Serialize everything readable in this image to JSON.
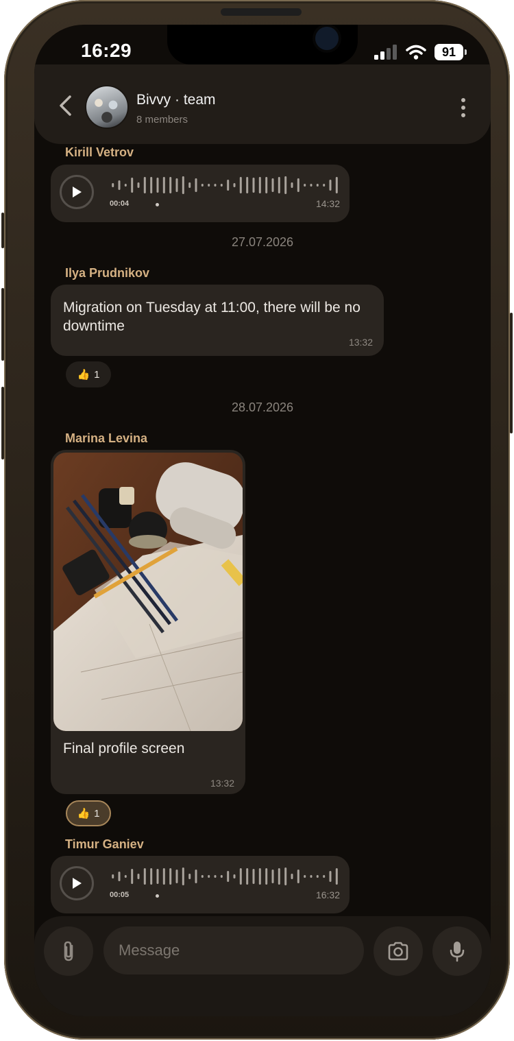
{
  "status": {
    "time": "16:29",
    "battery": "91"
  },
  "header": {
    "title": "Bivvy · team",
    "subtitle": "8 members"
  },
  "messages": [
    {
      "type": "voice",
      "sender": "Kirill Vetrov",
      "duration": "00:04",
      "time": "14:32"
    },
    {
      "type": "date",
      "label": "27.07.2026"
    },
    {
      "type": "text",
      "sender": "Ilya Prudnikov",
      "text": "Migration on Tuesday at 11:00, there will be no downtime",
      "time": "13:32",
      "reaction": {
        "emoji": "👍",
        "count": "1",
        "active": false
      }
    },
    {
      "type": "date",
      "label": "28.07.2026"
    },
    {
      "type": "photo",
      "sender": "Marina Levina",
      "caption": "Final profile screen",
      "time": "13:32",
      "reaction": {
        "emoji": "👍",
        "count": "1",
        "active": true
      }
    },
    {
      "type": "voice",
      "sender": "Timur Ganiev",
      "duration": "00:05",
      "time": "16:32"
    }
  ],
  "composer": {
    "placeholder": "Message"
  },
  "colors": {
    "sender": "#d5b183",
    "bubble": "#2a2520",
    "background": "#0f0c09",
    "reaction_active": "#a8875a"
  },
  "icons": [
    "back-icon",
    "more-vertical-icon",
    "play-icon",
    "paperclip-icon",
    "camera-icon",
    "microphone-icon",
    "wifi-icon",
    "signal-icon",
    "battery-icon"
  ]
}
